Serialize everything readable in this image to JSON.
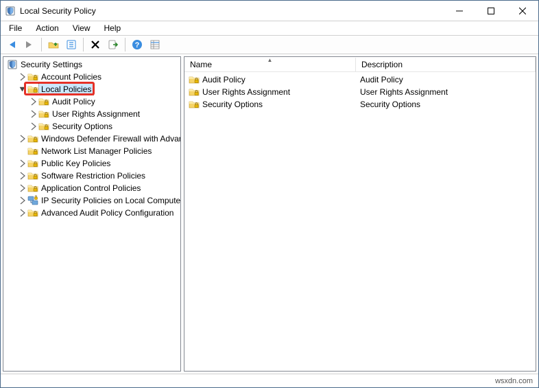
{
  "window": {
    "title": "Local Security Policy"
  },
  "menu": {
    "file": "File",
    "action": "Action",
    "view": "View",
    "help": "Help"
  },
  "tree": {
    "root": "Security Settings",
    "items": [
      {
        "label": "Account Policies",
        "depth": 1,
        "expander": ">"
      },
      {
        "label": "Local Policies",
        "depth": 1,
        "expander": "v",
        "selected": true,
        "highlighted": true
      },
      {
        "label": "Audit Policy",
        "depth": 2,
        "expander": ">"
      },
      {
        "label": "User Rights Assignment",
        "depth": 2,
        "expander": ">"
      },
      {
        "label": "Security Options",
        "depth": 2,
        "expander": ">"
      },
      {
        "label": "Windows Defender Firewall with Advanced Security",
        "depth": 1,
        "expander": ">"
      },
      {
        "label": "Network List Manager Policies",
        "depth": 1,
        "expander": ""
      },
      {
        "label": "Public Key Policies",
        "depth": 1,
        "expander": ">"
      },
      {
        "label": "Software Restriction Policies",
        "depth": 1,
        "expander": ">"
      },
      {
        "label": "Application Control Policies",
        "depth": 1,
        "expander": ">"
      },
      {
        "label": "IP Security Policies on Local Computer",
        "depth": 1,
        "expander": ">",
        "icon": "ipsec"
      },
      {
        "label": "Advanced Audit Policy Configuration",
        "depth": 1,
        "expander": ">"
      }
    ]
  },
  "list": {
    "columns": {
      "name": "Name",
      "description": "Description"
    },
    "rows": [
      {
        "name": "Audit Policy",
        "description": "Audit Policy"
      },
      {
        "name": "User Rights Assignment",
        "description": "User Rights Assignment"
      },
      {
        "name": "Security Options",
        "description": "Security Options"
      }
    ]
  },
  "footer": {
    "watermark": "wsxdn.com"
  }
}
